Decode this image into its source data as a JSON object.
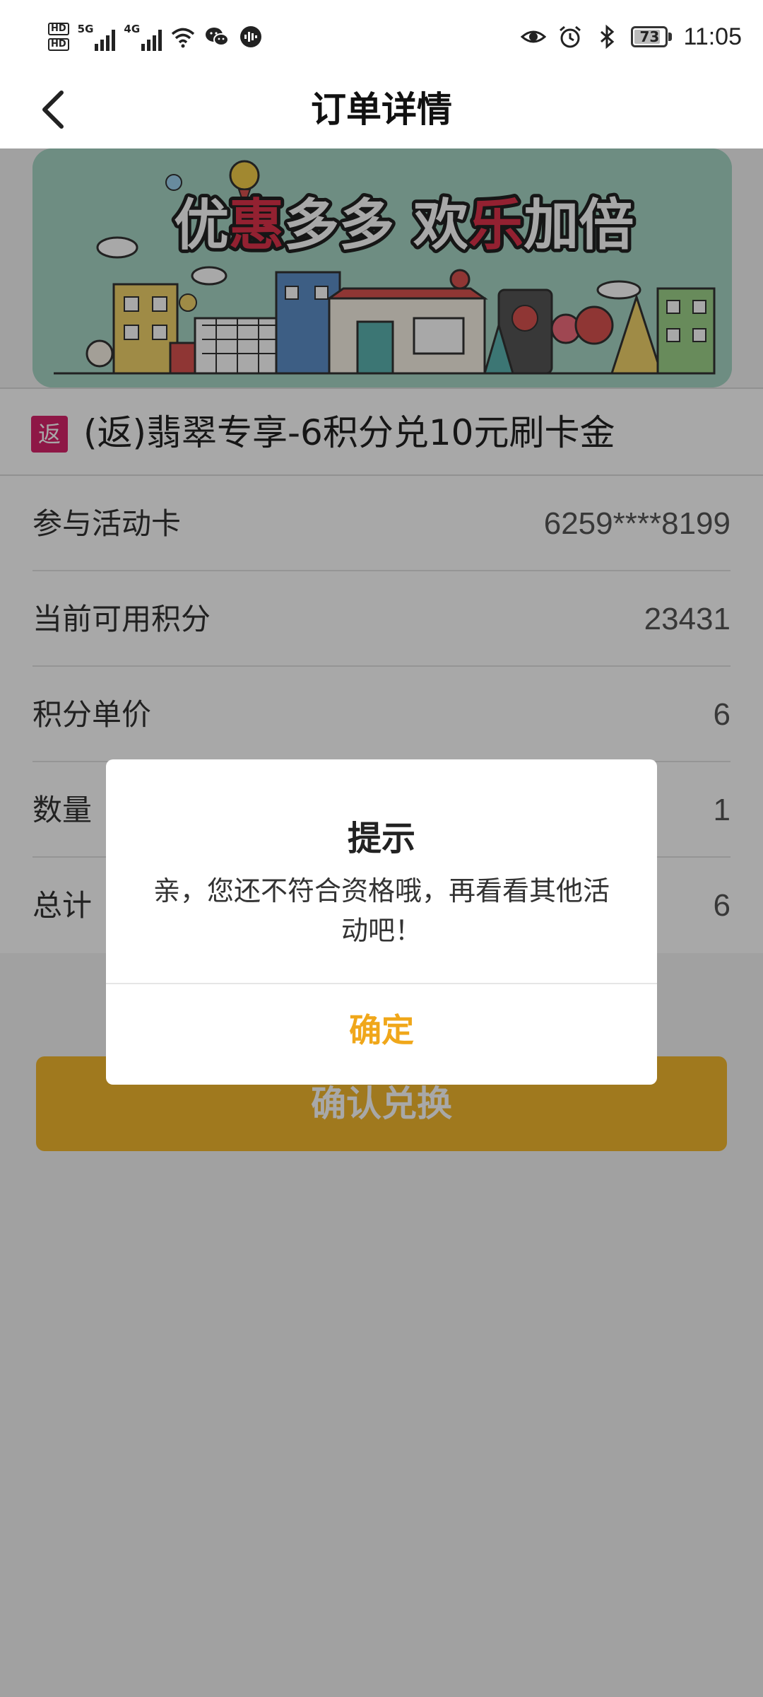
{
  "status_bar": {
    "hd_badges": [
      "HD",
      "HD"
    ],
    "network_1": "5G",
    "network_2": "4G",
    "battery_level": "73",
    "time": "11:05",
    "left_icons": [
      "signal-5g-icon",
      "signal-4g-icon",
      "wifi-icon",
      "wechat-icon",
      "voice-assistant-icon"
    ],
    "right_icons": [
      "eye-icon",
      "alarm-icon",
      "bluetooth-icon",
      "battery-icon"
    ]
  },
  "nav": {
    "title": "订单详情",
    "back_icon": "chevron-left-icon"
  },
  "banner": {
    "text_parts": [
      "优",
      "惠",
      "多多 ",
      "欢",
      "乐",
      "加倍"
    ]
  },
  "product": {
    "tag": "返",
    "title": "(返)翡翠专享-6积分兑10元刷卡金"
  },
  "rows": [
    {
      "label": "参与活动卡",
      "value": "6259****8199"
    },
    {
      "label": "当前可用积分",
      "value": "23431"
    },
    {
      "label": "积分单价",
      "value": "6"
    },
    {
      "label": "数量",
      "value": "1"
    },
    {
      "label": "总计",
      "value": "6"
    }
  ],
  "confirm_button": "确认兑换",
  "dialog": {
    "title": "提示",
    "message": "亲，您还不符合资格哦，再看看其他活动吧！",
    "ok_label": "确定"
  },
  "colors": {
    "primary": "#f3b82e",
    "dialog_ok": "#f0a71a",
    "tag": "#d8246b",
    "banner_bg": "#a7d6c5"
  }
}
